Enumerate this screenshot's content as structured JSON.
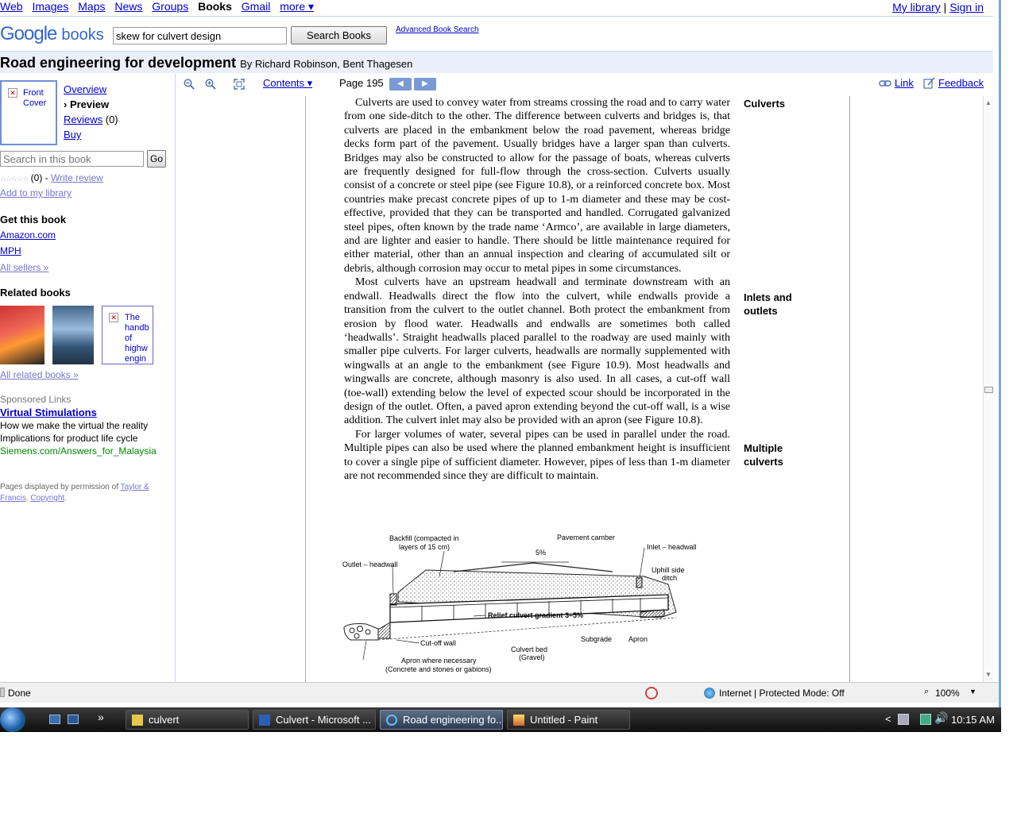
{
  "nav": {
    "items": [
      "Web",
      "Images",
      "Maps",
      "News",
      "Groups"
    ],
    "current": "Books",
    "gmail": "Gmail",
    "more": "more ▾",
    "my_library": "My library",
    "separator": "|",
    "sign_in": "Sign in"
  },
  "search": {
    "logo_google": "Google",
    "logo_books": "books",
    "query": "skew for culvert design",
    "button": "Search Books",
    "advanced": "Advanced Book Search"
  },
  "book": {
    "title": "Road engineering for development",
    "authors": "By Richard Robinson, Bent Thagesen"
  },
  "left": {
    "front_cover": "Front Cover",
    "overview": "Overview",
    "preview": "› Preview",
    "reviews": "Reviews",
    "reviews_count": " (0)",
    "buy": "Buy",
    "search_placeholder": "Search in this book",
    "go": "Go",
    "stars": "☆☆☆☆☆",
    "rating_count": " (0) - ",
    "write_review": "Write review",
    "add_library": "Add to my library",
    "get_book": "Get this book",
    "sellers": [
      "Amazon.com",
      "MPH"
    ],
    "all_sellers": "All sellers »",
    "related": "Related books",
    "related3": "The handb of highw engin",
    "all_related": "All related books »",
    "sponsored": "Sponsored Links",
    "ad_title": "Virtual Stimulations",
    "ad_line1": "How we make the virtual the reality",
    "ad_line2": " Implications for product life cycle",
    "ad_url": "Siemens.com/Answers_for_Malaysia",
    "perm_text": "Pages displayed by permission of ",
    "perm_publisher": "Taylor & Francis",
    "perm_dot": ". ",
    "copyright": "Copyright",
    "perm_end": "."
  },
  "toolbar": {
    "contents": "Contents ▾",
    "page": "Page 195",
    "prev": "◀",
    "next": "▶",
    "link": "Link",
    "feedback": "Feedback"
  },
  "page": {
    "p1": "Culverts are used to convey water from streams crossing the road and to carry water from one side-ditch to the other. The difference between culverts and bridges is, that culverts are placed in the embankment below the road pavement, whereas bridge decks form part of the pavement. Usually bridges have a larger span than culverts. Bridges may also be constructed to allow for the passage of boats, whereas culverts are frequently designed for full-flow through the cross-section. Culverts usually consist of a concrete or steel pipe (see Figure 10.8), or a reinforced concrete box. Most countries make precast concrete pipes of up to 1-m diameter and these may be cost-effective, provided that they can be transported and handled. Corrugated galvanized steel pipes, often known by the trade name ‘Armco’, are available in large diameters, and are lighter and easier to handle. There should be little maintenance required for either material, other than an annual inspection and clearing of accumulated silt or debris, although corrosion may occur to metal pipes in some circumstances.",
    "p2": "Most culverts have an upstream headwall and terminate downstream with an endwall. Headwalls direct the flow into the culvert, while endwalls provide a transition from the culvert to the outlet channel. Both protect the embankment from erosion by flood water. Headwalls and endwalls are sometimes both called ‘headwalls’. Straight headwalls placed parallel to the roadway are used mainly with smaller pipe culverts. For larger culverts, headwalls are normally supplemented with wingwalls at an angle to the embankment (see Figure 10.9). Most headwalls and wingwalls are concrete, although masonry is also used. In all cases, a cut-off wall (toe-wall) extending below the level of expected scour should be incorporated in the design of the outlet. Often, a paved apron extending beyond the cut-off wall, is a wise addition. The culvert inlet may also be provided with an apron (see Figure 10.8).",
    "p3": "For larger volumes of water, several pipes can be used in parallel under the road. Multiple pipes can also be used where the planned embankment height is insufficient to cover a single pipe of sufficient diameter. However, pipes of less than 1-m diameter are not recommended since they are difficult to maintain.",
    "margin1": "Culverts",
    "margin2a": "Inlets and",
    "margin2b": "outlets",
    "margin3a": "Multiple",
    "margin3b": "culverts",
    "fig": {
      "backfill1": "Backfill (compacted in",
      "backfill2": "layers of 15 cm)",
      "camber": "Pavement camber",
      "pct": "5%",
      "inlet": "Inlet – headwall",
      "outlet": "Outlet – headwall",
      "uphill1": "Uphill side",
      "uphill2": "ditch",
      "gradient": "Relief culvert gradient 3–5%",
      "cutoff": "Cut-off wall",
      "subgrade": "Subgrade",
      "apron": "Apron",
      "bed1": "Culvert bed",
      "bed2": "(Gravel)",
      "apron_where1": "Apron where necessary",
      "apron_where2": "(Concrete and stones or gabions)"
    }
  },
  "status": {
    "done": "Done",
    "zone": "Internet | Protected Mode: Off",
    "zoom": "100%"
  },
  "taskbar": {
    "tasks": [
      "culvert",
      "Culvert - Microsoft ...",
      "Road engineering fo...",
      "Untitled - Paint"
    ],
    "chevron": "»",
    "tray_chevron": "<",
    "clock": "10:15 AM"
  },
  "colors": {
    "link": "#0000cc",
    "ad_url": "#008000",
    "title_band": "#ebeff9",
    "accent": "#7a9ad4"
  }
}
